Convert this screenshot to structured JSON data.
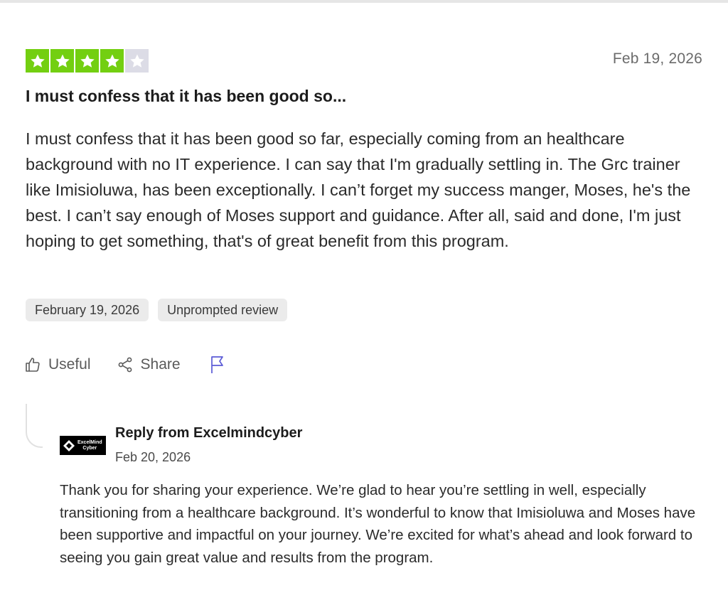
{
  "review": {
    "rating": 4,
    "max_rating": 5,
    "star_color_filled": "#73cf11",
    "star_color_empty": "#dcdce6",
    "date": "Feb 19, 2026",
    "title": "I must confess that it has been good so...",
    "body": "I must confess that it has been good so far, especially coming from an healthcare background with no IT experience. I can say that I'm gradually settling in. The Grc trainer like Imisioluwa, has been exceptionally. I can’t forget my success manger, Moses, he's the best. I can’t say enough of Moses support and guidance. After all, said and done, I'm just hoping to get something, that's of great benefit from this program.",
    "chips": [
      "February 19, 2026",
      "Unprompted review"
    ]
  },
  "actions": {
    "useful_label": "Useful",
    "share_label": "Share",
    "useful_icon": "thumbs-up-icon",
    "share_icon": "share-icon",
    "report_icon": "flag-icon",
    "flag_color": "#5b5bd6"
  },
  "reply": {
    "logo_text_line1": "ExcelMind",
    "logo_text_line2": "Cyber",
    "header": "Reply from Excelmindcyber",
    "date": "Feb 20, 2026",
    "body": "Thank you for sharing your experience. We’re glad to hear you’re settling in well, especially transitioning from a healthcare background. It’s wonderful to know that Imisioluwa and Moses have been supportive and impactful on your journey. We’re excited for what’s ahead and look forward to seeing you gain great value and results from the program."
  }
}
